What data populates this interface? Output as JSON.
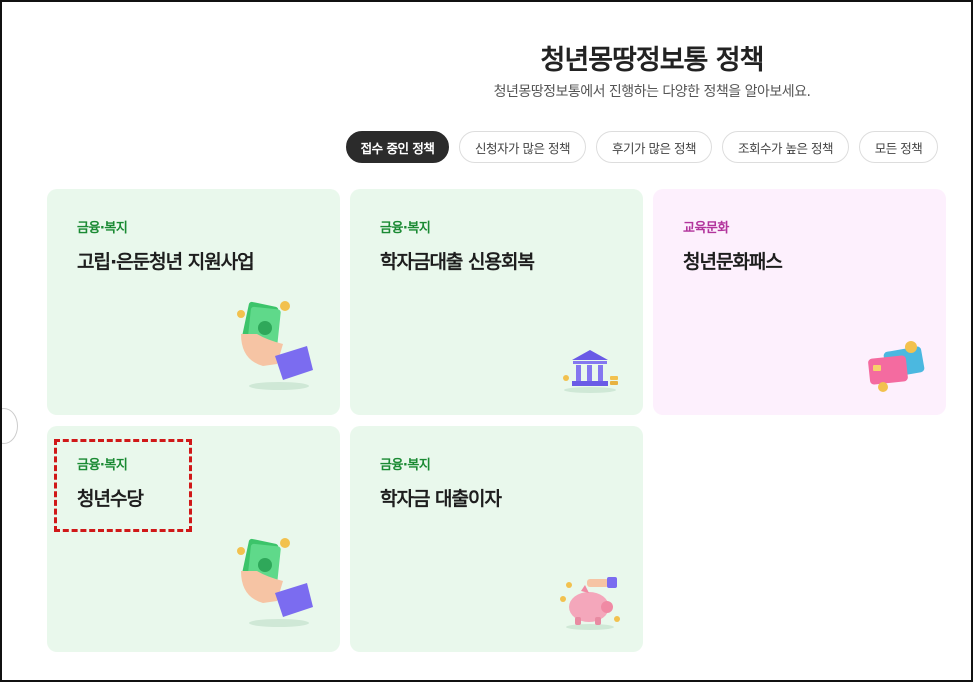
{
  "header": {
    "title": "청년몽땅정보통 정책",
    "subtitle": "청년몽땅정보통에서 진행하는 다양한 정책을 알아보세요."
  },
  "tabs": [
    {
      "label": "접수 중인 정책",
      "active": true
    },
    {
      "label": "신청자가 많은 정책",
      "active": false
    },
    {
      "label": "후기가 많은 정책",
      "active": false
    },
    {
      "label": "조회수가 높은 정책",
      "active": false
    },
    {
      "label": "모든 정책",
      "active": false
    }
  ],
  "cards": [
    {
      "category": "금융·복지",
      "title": "고립·은둔청년 지원사업",
      "icon": "money-hand-icon",
      "theme": "green"
    },
    {
      "category": "금융·복지",
      "title": "학자금대출 신용회복",
      "icon": "bank-building-icon",
      "theme": "green"
    },
    {
      "category": "교육문화",
      "title": "청년문화패스",
      "icon": "credit-cards-icon",
      "theme": "pink"
    },
    {
      "category": "금융·복지",
      "title": "청년수당",
      "icon": "money-hand-icon",
      "theme": "green"
    },
    {
      "category": "금융·복지",
      "title": "학자금 대출이자",
      "icon": "piggy-bank-icon",
      "theme": "green"
    }
  ],
  "colors": {
    "green_bg": "#e9f8ec",
    "pink_bg": "#fdf0fd",
    "green_text": "#1a8a33",
    "pink_text": "#b2349c",
    "active_tab": "#2b2b2b",
    "highlight": "#d01818"
  }
}
